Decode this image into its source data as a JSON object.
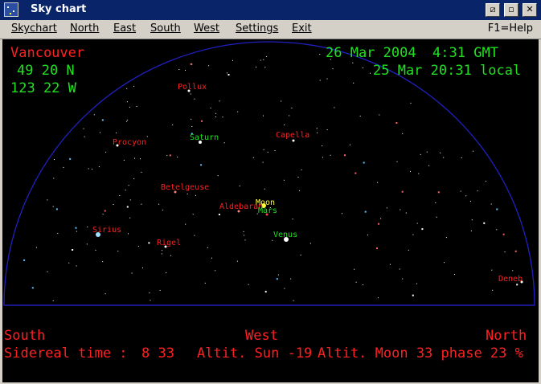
{
  "window": {
    "title": "Sky chart",
    "buttons": {
      "restore": "⧄",
      "minimize": "▫",
      "close": "✕"
    }
  },
  "menu": {
    "items": [
      "Skychart",
      "North",
      "East",
      "South",
      "West",
      "Settings",
      "Exit"
    ],
    "help": "F1=Help"
  },
  "location": {
    "city": "Vancouver",
    "latitude": "49 20 N",
    "longitude": "123 22 W"
  },
  "time": {
    "gmt": "26 Mar 2004  4:31 GMT",
    "local": "25 Mar 20:31 local"
  },
  "sky_labels": [
    {
      "name": "Pollux",
      "color": "#ff2020"
    },
    {
      "name": "Procyon",
      "color": "#ff2020"
    },
    {
      "name": "Saturn",
      "color": "#20e020"
    },
    {
      "name": "Capella",
      "color": "#ff2020"
    },
    {
      "name": "Betelgeuse",
      "color": "#ff2020"
    },
    {
      "name": "Moon",
      "color": "#ffff40"
    },
    {
      "name": "Aldebaran",
      "color": "#ff2020"
    },
    {
      "name": "Mars",
      "color": "#20e020"
    },
    {
      "name": "Sirius",
      "color": "#ff2020"
    },
    {
      "name": "Venus",
      "color": "#20e020"
    },
    {
      "name": "Rigel",
      "color": "#ff2020"
    },
    {
      "name": "Deneb",
      "color": "#ff2020"
    }
  ],
  "horizon": {
    "left": "South",
    "center": "West",
    "right": "North"
  },
  "status": {
    "sidereal_label": "Sidereal time :",
    "sidereal_value": "8 33",
    "sun_altitude": "Altit. Sun -19",
    "moon_info": "Altit. Moon 33 phase 23 %"
  },
  "colors": {
    "background": "#000000",
    "horizon_arc": "#2020c0",
    "label_red": "#ff2020",
    "label_green": "#20e020"
  }
}
